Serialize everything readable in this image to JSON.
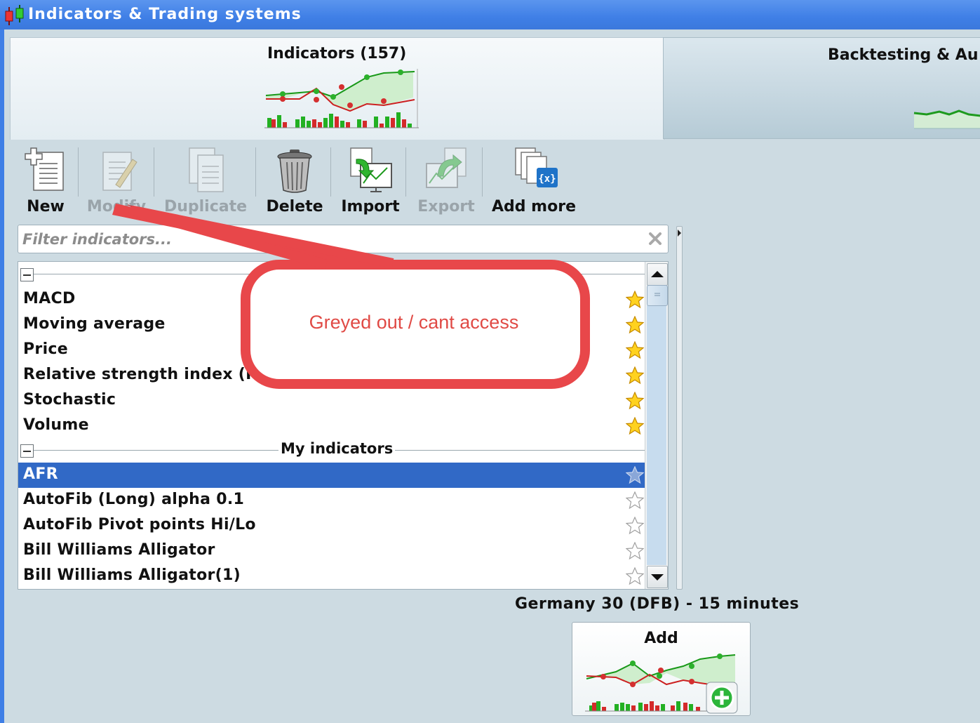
{
  "window": {
    "title": "Indicators & Trading systems"
  },
  "tabs": {
    "indicators": "Indicators (157)",
    "backtesting": "Backtesting & Au"
  },
  "toolbar": {
    "new": "New",
    "modify": "Modify",
    "duplicate": "Duplicate",
    "delete": "Delete",
    "import": "Import",
    "export": "Export",
    "add_more": "Add more"
  },
  "filter": {
    "placeholder": "Filter indicators..."
  },
  "list": {
    "favorites": [
      {
        "label": "MACD",
        "favorite": true
      },
      {
        "label": "Moving average",
        "favorite": true
      },
      {
        "label": "Price",
        "favorite": true
      },
      {
        "label": "Relative strength index (R",
        "favorite": true
      },
      {
        "label": "Stochastic",
        "favorite": true
      },
      {
        "label": "Volume",
        "favorite": true
      }
    ],
    "my_indicators_header": "My indicators",
    "my_indicators": [
      {
        "label": "AFR",
        "favorite": false,
        "selected": true
      },
      {
        "label": "AutoFib (Long) alpha 0.1",
        "favorite": false
      },
      {
        "label": "AutoFib Pivot points Hi/Lo",
        "favorite": false
      },
      {
        "label": "Bill Williams Alligator",
        "favorite": false
      },
      {
        "label": "Bill Williams Alligator(1)",
        "favorite": false
      }
    ]
  },
  "market": {
    "label": "Germany 30 (DFB) - 15 minutes"
  },
  "add_button": {
    "label": "Add"
  },
  "annotation": {
    "text": "Greyed out / cant access"
  },
  "colors": {
    "titlebar": "#3f7fe6",
    "selection": "#3169c6",
    "annotation": "#e04a45",
    "disabled_text": "#9aa4aa"
  }
}
